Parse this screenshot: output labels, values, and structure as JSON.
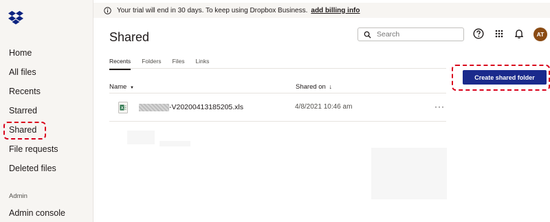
{
  "sidebar": {
    "items": [
      {
        "label": "Home"
      },
      {
        "label": "All files"
      },
      {
        "label": "Recents"
      },
      {
        "label": "Starred"
      },
      {
        "label": "Shared"
      },
      {
        "label": "File requests"
      },
      {
        "label": "Deleted files"
      }
    ],
    "admin_section": "Admin",
    "admin_console": "Admin console"
  },
  "banner": {
    "message": "Your trial will end in 30 days. To keep using Dropbox Business.",
    "link": "add billing info"
  },
  "header": {
    "title": "Shared",
    "search_placeholder": "Search",
    "avatar_initials": "AT"
  },
  "tabs": [
    {
      "label": "Recents",
      "active": true
    },
    {
      "label": "Folders"
    },
    {
      "label": "Files"
    },
    {
      "label": "Links"
    }
  ],
  "table": {
    "col_name": "Name",
    "col_shared_on": "Shared on",
    "rows": [
      {
        "name_suffix": "-V20200413185205.xls",
        "shared_on": "4/8/2021 10:46 am",
        "more": "···"
      }
    ]
  },
  "actions": {
    "create_shared_folder": "Create shared folder"
  },
  "colors": {
    "accent": "#1a2a8c",
    "highlight": "#d9001b",
    "avatar": "#8a4b14"
  }
}
